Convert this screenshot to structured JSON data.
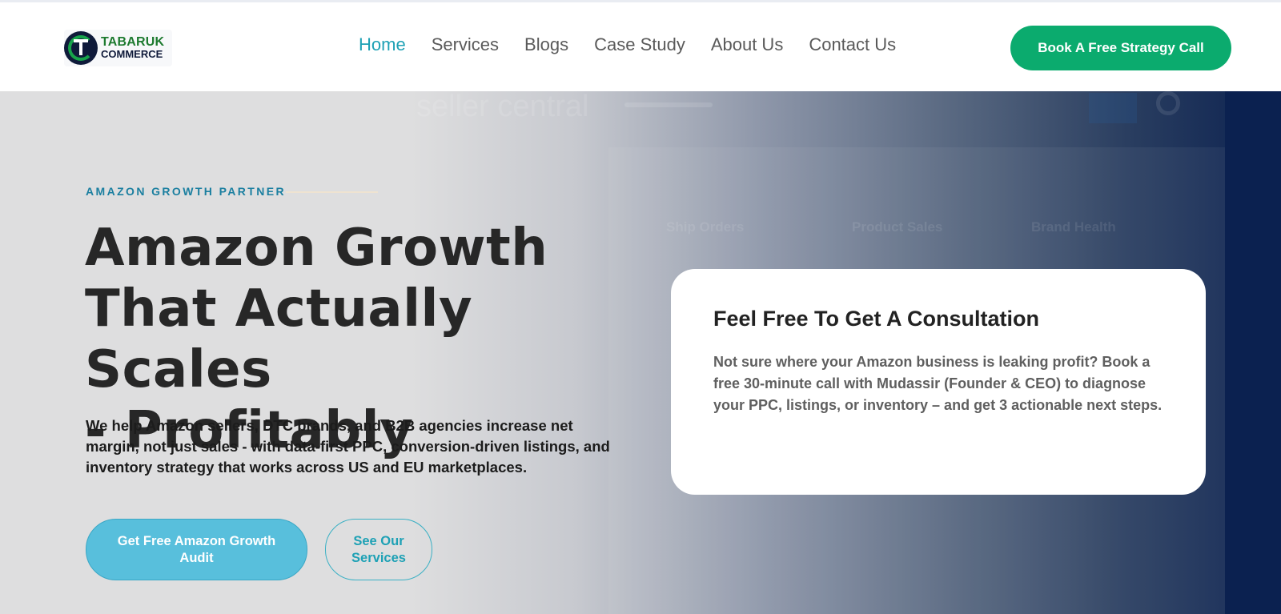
{
  "header": {
    "logo_line1": "TABARUK",
    "logo_line2": "COMMERCE",
    "nav": [
      {
        "label": "Home",
        "active": true
      },
      {
        "label": "Services",
        "active": false
      },
      {
        "label": "Blogs",
        "active": false
      },
      {
        "label": "Case Study",
        "active": false
      },
      {
        "label": "About Us",
        "active": false
      },
      {
        "label": "Contact Us",
        "active": false
      }
    ],
    "cta_label": "Book A Free Strategy Call"
  },
  "hero": {
    "eyebrow": "AMAZON GROWTH PARTNER",
    "title_line1": "Amazon Growth",
    "title_line2": "That Actually Scales",
    "title_line3": "- Profitably",
    "lead": "We help Amazon sellers, DTC brands, and B2B agencies increase net margin, not just sales - with data-first PPC, conversion-driven listings, and inventory strategy that works across US and EU marketplaces.",
    "primary_button": "Get Free Amazon Growth Audit",
    "secondary_button": "See Our Services",
    "background_ghost": {
      "title": "seller central",
      "tabs": [
        "Ship Orders",
        "Product Sales",
        "Brand Health"
      ]
    }
  },
  "consult_card": {
    "title": "Feel Free To Get A Consultation",
    "body": "Not sure where your Amazon business is leaking profit? Book a free 30-minute call with Mudassir (Founder & CEO) to diagnose your PPC, listings, or inventory – and get 3 actionable next steps."
  },
  "colors": {
    "accent_teal": "#1ea1b5",
    "cta_green": "#0bab6e",
    "primary_button": "#58bfdc",
    "heading": "#272727",
    "navy": "#0b2150"
  }
}
